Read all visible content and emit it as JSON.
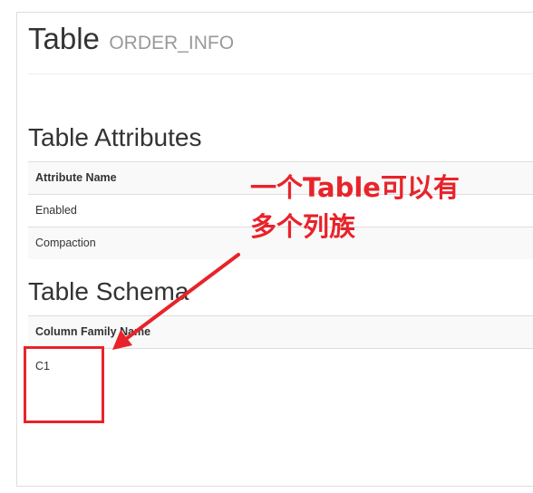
{
  "header": {
    "title": "Table",
    "table_name": "ORDER_INFO"
  },
  "attributes_section": {
    "heading": "Table Attributes",
    "column_header": "Attribute Name",
    "rows": [
      "Enabled",
      "Compaction"
    ]
  },
  "schema_section": {
    "heading": "Table Schema",
    "column_header": "Column Family Name",
    "rows": [
      "C1"
    ]
  },
  "annotation": {
    "line1": "一个Table可以有",
    "line2": "多个列族",
    "color": "#e8232a"
  }
}
